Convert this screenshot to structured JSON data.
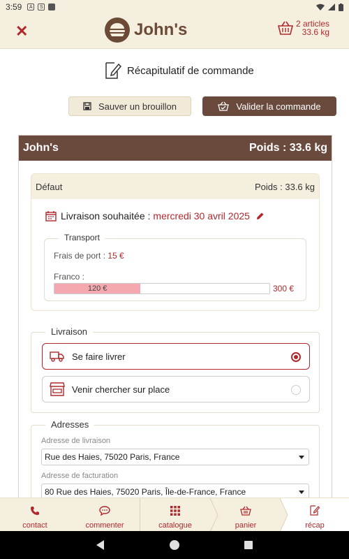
{
  "status_bar": {
    "time": "3:59"
  },
  "header": {
    "brand": "John's",
    "cart_articles": "2 articles",
    "cart_weight": "33.6 kg"
  },
  "page": {
    "title": "Récapitulatif de commande",
    "save_draft_label": "Sauver un brouillon",
    "validate_label": "Valider la commande"
  },
  "supplier": {
    "name": "John's",
    "weight": "Poids : 33.6 kg",
    "order": {
      "name": "Défaut",
      "weight": "Poids : 33.6 kg",
      "delivery_wish_label": "Livraison souhaitée :",
      "delivery_wish_date": "mercredi 30 avril 2025",
      "transport": {
        "legend": "Transport",
        "fees_label": "Frais de port :",
        "fees_value": "15 €",
        "franco_label": "Franco :",
        "progress_value": "120 €",
        "progress_max": "300 €",
        "progress_fraction": 0.4
      }
    }
  },
  "livraison": {
    "legend": "Livraison",
    "options": [
      {
        "label": "Se faire livrer",
        "selected": true
      },
      {
        "label": "Venir chercher sur place",
        "selected": false
      }
    ]
  },
  "adresses": {
    "legend": "Adresses",
    "delivery_label": "Adresse de livraison",
    "delivery_value": "Rue des Haies, 75020 Paris, France",
    "billing_label": "Adresse de facturation",
    "billing_value": "80 Rue des Haies, 75020 Paris, Île-de-France, France"
  },
  "bottom_nav": {
    "contact": "contact",
    "commenter": "commenter",
    "catalogue": "catalogue",
    "panier": "panier",
    "recap": "récap"
  },
  "colors": {
    "accent_red": "#b0282c",
    "brown": "#6b4a3e",
    "cream": "#f5efe0"
  }
}
